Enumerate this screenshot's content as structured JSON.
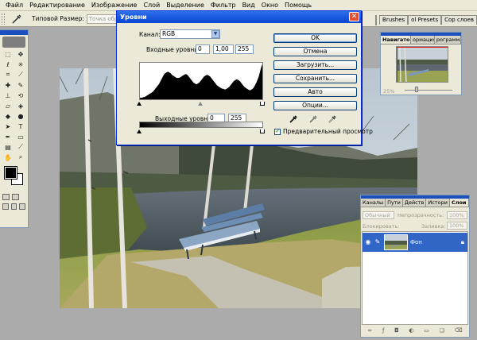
{
  "menubar": {
    "items": [
      "Файл",
      "Редактирование",
      "Изображение",
      "Слой",
      "Выделение",
      "Фильтр",
      "Вид",
      "Окно",
      "Помощь"
    ]
  },
  "options_bar": {
    "sample_size_label": "Типовой Размер:",
    "sample_size_value": "Точка образца",
    "palette_tabs": [
      "Brushes",
      "ol Presets",
      "Сор слоев"
    ]
  },
  "levels": {
    "title": "Уровни",
    "channel_label": "Канал:",
    "channel_value": "RGB",
    "input_label": "Входные уровни:",
    "input_values": [
      "0",
      "1,00",
      "255"
    ],
    "output_label": "Выходные уровни:",
    "output_values": [
      "0",
      "255"
    ],
    "buttons": [
      "OK",
      "Отмена",
      "Загрузить...",
      "Сохранить...",
      "Авто",
      "Опции..."
    ],
    "preview_label": "Предварительный просмотр",
    "preview_checked": true,
    "histogram": [
      2,
      2,
      2,
      3,
      3,
      4,
      5,
      6,
      7,
      8,
      9,
      10,
      12,
      14,
      16,
      18,
      20,
      23,
      26,
      29,
      32,
      34,
      35,
      36,
      36,
      35,
      34,
      32,
      31,
      30,
      29,
      28,
      28,
      28,
      29,
      30,
      31,
      32,
      33,
      33,
      32,
      30,
      28,
      26,
      24,
      22,
      21,
      20,
      20,
      21,
      22,
      24,
      26,
      28,
      30,
      31,
      32,
      32,
      31,
      30,
      28,
      26,
      24,
      22,
      20,
      18,
      17,
      16,
      15,
      14,
      14,
      13,
      13,
      14,
      15,
      16,
      18,
      20,
      22,
      24,
      25,
      26,
      26,
      25,
      24,
      22,
      20,
      18,
      16,
      15,
      14,
      13,
      12,
      12,
      13,
      14,
      16,
      19,
      22,
      26,
      30,
      36,
      42,
      46
    ]
  },
  "navigator": {
    "tabs": [
      "Навигатор",
      "ормация",
      "рограмма"
    ],
    "zoom": "25%"
  },
  "layers": {
    "tabs": [
      "Каналы",
      "Пути",
      "Действ",
      "Истори",
      "Слои"
    ],
    "mode": "Обычный",
    "opacity_label": "Непрозрачность:",
    "opacity_value": "100%",
    "lock_label": "Блокировать:",
    "fill_label": "Заливка:",
    "fill_value": "100%",
    "layer_name": "Фон",
    "footer_icons": [
      "link-icon",
      "fx-icon",
      "mask-icon",
      "adjustment-icon",
      "folder-icon",
      "new-layer-icon",
      "trash-icon"
    ]
  }
}
